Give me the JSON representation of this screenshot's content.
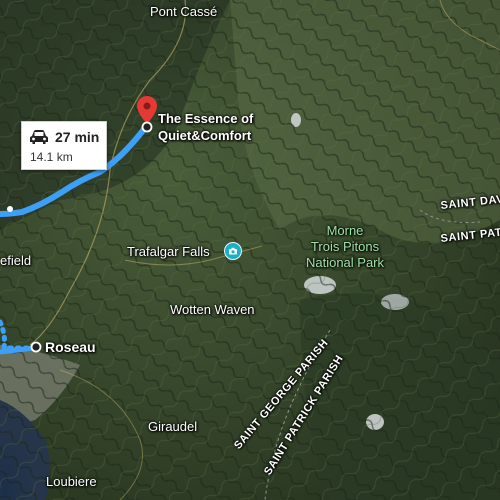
{
  "map": {
    "route": {
      "duration": "27 min",
      "distance": "14.1 km",
      "mode_icon": "car-icon",
      "color": "#3d9ff7"
    },
    "destination": {
      "name_line1": "The Essence of",
      "name_line2": "Quiet&Comfort",
      "pin_color": "#e53935"
    },
    "origin": {
      "name": "Roseau"
    },
    "places": {
      "pont_casse": "Pont Cassé",
      "trafalgar_falls": "Trafalgar Falls",
      "wotten_waven": "Wotten Waven",
      "giraudel": "Giraudel",
      "loubiere": "Loubiere",
      "efield": "efield"
    },
    "park": {
      "line1": "Morne",
      "line2": "Trois Pitons",
      "line3": "National Park",
      "color": "#9fe2a7",
      "icon": "park-icon"
    },
    "parishes": {
      "saint_david": "SAINT DAV",
      "saint_patrick_ne": "SAINT PAT",
      "saint_george": "SAINT GEORGE PARISH",
      "saint_patrick": "SAINT PATRICK PARISH"
    },
    "poi_icon_color": "#1bb0c6"
  }
}
